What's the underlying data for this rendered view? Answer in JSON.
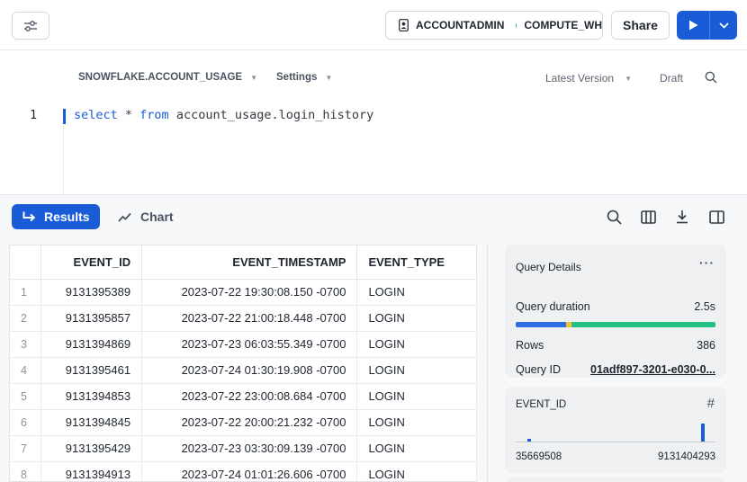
{
  "topbar": {
    "role": "ACCOUNTADMIN",
    "warehouse": "COMPUTE_WH",
    "share_label": "Share"
  },
  "editor": {
    "database": "SNOWFLAKE.ACCOUNT_USAGE",
    "settings_label": "Settings",
    "version_label": "Latest Version",
    "draft_label": "Draft",
    "line_number": "1",
    "code": {
      "kw_select": "select",
      "star": " * ",
      "kw_from": "from",
      "rest": " account_usage.login_history"
    }
  },
  "results_bar": {
    "results_label": "Results",
    "chart_label": "Chart"
  },
  "table": {
    "columns": [
      "EVENT_ID",
      "EVENT_TIMESTAMP",
      "EVENT_TYPE"
    ],
    "rows": [
      {
        "idx": "1",
        "event_id": "9131395389",
        "ts": "2023-07-22 19:30:08.150 -0700",
        "type": "LOGIN"
      },
      {
        "idx": "2",
        "event_id": "9131395857",
        "ts": "2023-07-22 21:00:18.448 -0700",
        "type": "LOGIN"
      },
      {
        "idx": "3",
        "event_id": "9131394869",
        "ts": "2023-07-23 06:03:55.349 -0700",
        "type": "LOGIN"
      },
      {
        "idx": "4",
        "event_id": "9131395461",
        "ts": "2023-07-24 01:30:19.908 -0700",
        "type": "LOGIN"
      },
      {
        "idx": "5",
        "event_id": "9131394853",
        "ts": "2023-07-22 23:00:08.684 -0700",
        "type": "LOGIN"
      },
      {
        "idx": "6",
        "event_id": "9131394845",
        "ts": "2023-07-22 20:00:21.232 -0700",
        "type": "LOGIN"
      },
      {
        "idx": "7",
        "event_id": "9131395429",
        "ts": "2023-07-23 03:30:09.139 -0700",
        "type": "LOGIN"
      },
      {
        "idx": "8",
        "event_id": "9131394913",
        "ts": "2023-07-24 01:01:26.606 -0700",
        "type": "LOGIN"
      }
    ]
  },
  "query_details": {
    "title": "Query Details",
    "duration_label": "Query duration",
    "duration_value": "2.5s",
    "duration_segments": [
      {
        "fraction": 0.25,
        "color": "#2e6ee0"
      },
      {
        "fraction": 0.03,
        "color": "#f2c233"
      },
      {
        "fraction": 0.72,
        "color": "#21c083"
      }
    ],
    "rows_label": "Rows",
    "rows_value": "386",
    "query_id_label": "Query ID",
    "query_id_value": "01adf897-3201-e030-0..."
  },
  "column_stats": {
    "name": "EVENT_ID",
    "min": "35669508",
    "max": "9131404293",
    "histogram": [
      {
        "position": 0.06,
        "level": 0.12
      },
      {
        "position": 0.93,
        "level": 0.85
      }
    ]
  },
  "colors": {
    "accent": "#1a5cd8",
    "warehouse_dot": "#29b57d"
  }
}
